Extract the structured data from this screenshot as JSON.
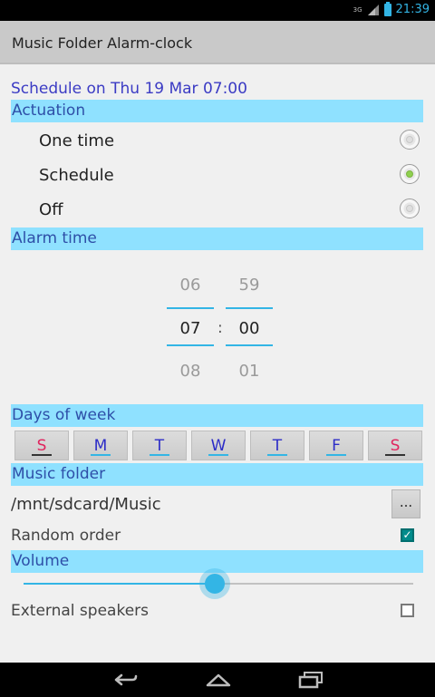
{
  "status_bar": {
    "network": "3G",
    "time": "21:39"
  },
  "app": {
    "title": "Music Folder Alarm-clock"
  },
  "schedule_summary": "Schedule on Thu 19 Mar 07:00",
  "sections": {
    "actuation": "Actuation",
    "alarm_time": "Alarm time",
    "days_of_week": "Days of week",
    "music_folder": "Music folder",
    "volume": "Volume"
  },
  "actuation_options": [
    {
      "label": "One time",
      "selected": false
    },
    {
      "label": "Schedule",
      "selected": true
    },
    {
      "label": "Off",
      "selected": false
    }
  ],
  "time_picker": {
    "hour_prev": "06",
    "hour": "07",
    "hour_next": "08",
    "separator": ":",
    "minute_prev": "59",
    "minute": "00",
    "minute_next": "01"
  },
  "days": [
    {
      "label": "S",
      "color": "#e0245e",
      "underline": "#333333"
    },
    {
      "label": "M",
      "color": "#2c2cc7",
      "underline": "#33b5e5"
    },
    {
      "label": "T",
      "color": "#2c2cc7",
      "underline": "#33b5e5"
    },
    {
      "label": "W",
      "color": "#2c2cc7",
      "underline": "#33b5e5"
    },
    {
      "label": "T",
      "color": "#2c2cc7",
      "underline": "#33b5e5"
    },
    {
      "label": "F",
      "color": "#2c2cc7",
      "underline": "#33b5e5"
    },
    {
      "label": "S",
      "color": "#e0245e",
      "underline": "#333333"
    }
  ],
  "music": {
    "path": "/mnt/sdcard/Music",
    "browse_label": "..."
  },
  "random_order": {
    "label": "Random order",
    "checked": true
  },
  "volume_level": 0.49,
  "external_speakers": {
    "label": "External speakers",
    "checked": false
  },
  "colors": {
    "section_bg": "#8fe1ff",
    "accent": "#33b5e5",
    "schedule_text": "#3b3bc4"
  },
  "icons": {
    "back": "back-icon",
    "home": "home-icon",
    "recents": "recent-apps-icon",
    "battery": "battery-icon",
    "signal": "signal-icon"
  }
}
